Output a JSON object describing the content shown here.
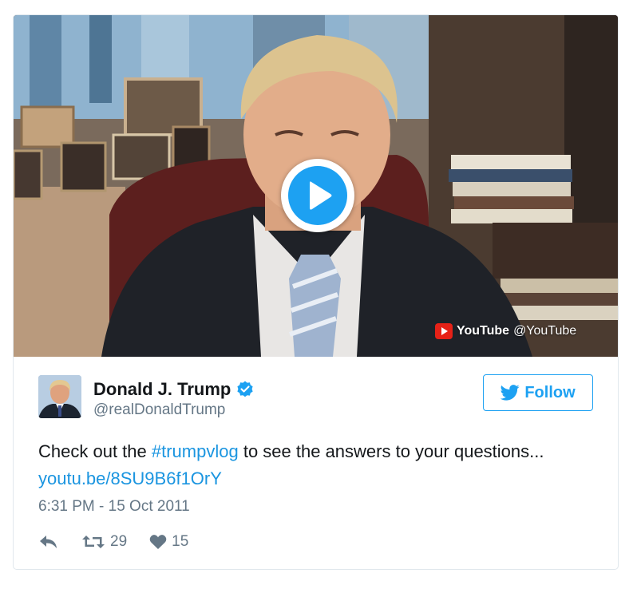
{
  "media": {
    "provider_name": "YouTube",
    "provider_handle": "@YouTube"
  },
  "author": {
    "name": "Donald J. Trump",
    "handle": "@realDonaldTrump"
  },
  "follow": {
    "label": "Follow"
  },
  "tweet": {
    "text_before": "Check out the ",
    "hashtag": "#trumpvlog",
    "text_middle": " to see the answers to your questions... ",
    "link": "youtu.be/8SU9B6f1OrY"
  },
  "timestamp": "6:31 PM - 15 Oct 2011",
  "actions": {
    "reply_icon": "reply-icon",
    "retweet_count": "29",
    "like_count": "15"
  },
  "colors": {
    "accent": "#1da1f2",
    "link": "#1b95e0",
    "muted": "#657786",
    "youtube_red": "#e62117"
  }
}
